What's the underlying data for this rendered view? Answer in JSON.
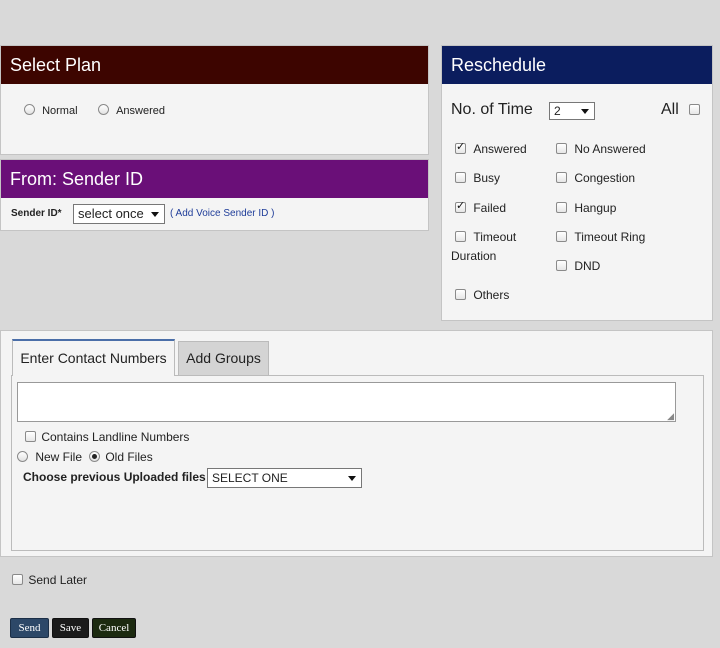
{
  "select_plan": {
    "title": "Select Plan",
    "options": [
      "Normal",
      "Answered"
    ]
  },
  "sender": {
    "title": "From: Sender ID",
    "label": "Sender ID*",
    "select_value": "select once",
    "add_link": "( Add Voice Sender ID )"
  },
  "reschedule": {
    "title": "Reschedule",
    "no_of_time_label": "No. of Time",
    "no_of_time_value": "2",
    "all_label": "All",
    "left_options": [
      {
        "label": "Answered",
        "checked": true
      },
      {
        "label": "Busy",
        "checked": false
      },
      {
        "label": "Failed",
        "checked": true
      },
      {
        "label": "Timeout",
        "label2": "Duration",
        "checked": false
      },
      {
        "label": "Others",
        "checked": false
      }
    ],
    "right_options": [
      {
        "label": "No Answered",
        "checked": false
      },
      {
        "label": "Congestion",
        "checked": false
      },
      {
        "label": "Hangup",
        "checked": false
      },
      {
        "label": "Timeout Ring",
        "checked": false
      },
      {
        "label": "DND",
        "checked": false
      }
    ]
  },
  "contacts": {
    "tabs": [
      "Enter Contact Numbers",
      "Add Groups"
    ],
    "landline_label": "Contains Landline Numbers",
    "new_file_label": "New File",
    "old_files_label": "Old Files",
    "choose_label": "Choose previous Uploaded files",
    "choose_value": "SELECT ONE"
  },
  "send_later_label": "Send Later",
  "buttons": {
    "send": "Send",
    "save": "Save",
    "cancel": "Cancel"
  },
  "colors": {
    "select_plan_header": "#3d0500",
    "sender_header": "#6a0f78",
    "reschedule_header": "#0b1d5e",
    "send_button": "#2d4868",
    "save_button": "#1b1b1b",
    "cancel_button": "#1c2a10"
  }
}
